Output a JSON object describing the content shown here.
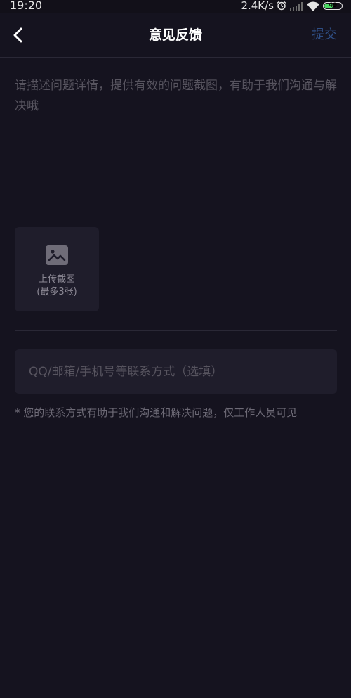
{
  "status_bar": {
    "time": "19:20",
    "network_speed": "2.4K/s",
    "battery_level": "49",
    "battery_fraction": 0.49,
    "icons": [
      "alarm-icon",
      "signal-icon",
      "wifi-icon",
      "battery-icon"
    ]
  },
  "header": {
    "back_icon": "chevron-left-icon",
    "title": "意见反馈",
    "submit_label": "提交"
  },
  "feedback": {
    "description_placeholder": "请描述问题详情，提供有效的问题截图，有助于我们沟通与解决哦",
    "description_value": ""
  },
  "upload": {
    "icon": "image-icon",
    "label": "上传截图",
    "sublabel": "(最多3张)"
  },
  "contact": {
    "placeholder": "QQ/邮箱/手机号等联系方式（选填）",
    "value": ""
  },
  "note": "* 您的联系方式有助于我们沟通和解决问题，仅工作人员可见",
  "colors": {
    "background": "#15131f",
    "card": "#1f1d2b",
    "submit": "#2f4e84",
    "placeholder": "#57545f",
    "note": "#6d6a76"
  }
}
